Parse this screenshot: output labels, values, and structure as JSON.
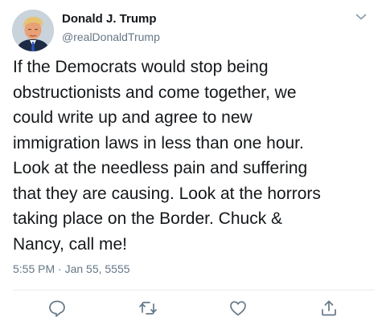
{
  "author": {
    "name": "Donald J. Trump",
    "handle": "@realDonaldTrump"
  },
  "tweet": {
    "text": "If the Democrats would stop being\nobstructionists and come together, we\ncould write up and agree to new\nimmigration laws in less than one hour.\nLook at the needless pain and suffering\nthat they are causing. Look at the horrors\ntaking place on the Border. Chuck &\nNancy, call me!",
    "timestamp": "5:55 PM · Jan 55, 5555"
  },
  "icons": {
    "menu": "chevron-down-icon",
    "reply": "reply-icon",
    "retweet": "retweet-icon",
    "like": "heart-icon",
    "share": "share-icon"
  },
  "colors": {
    "text": "#14171a",
    "secondary": "#657786",
    "divider": "#e6ecf0"
  }
}
